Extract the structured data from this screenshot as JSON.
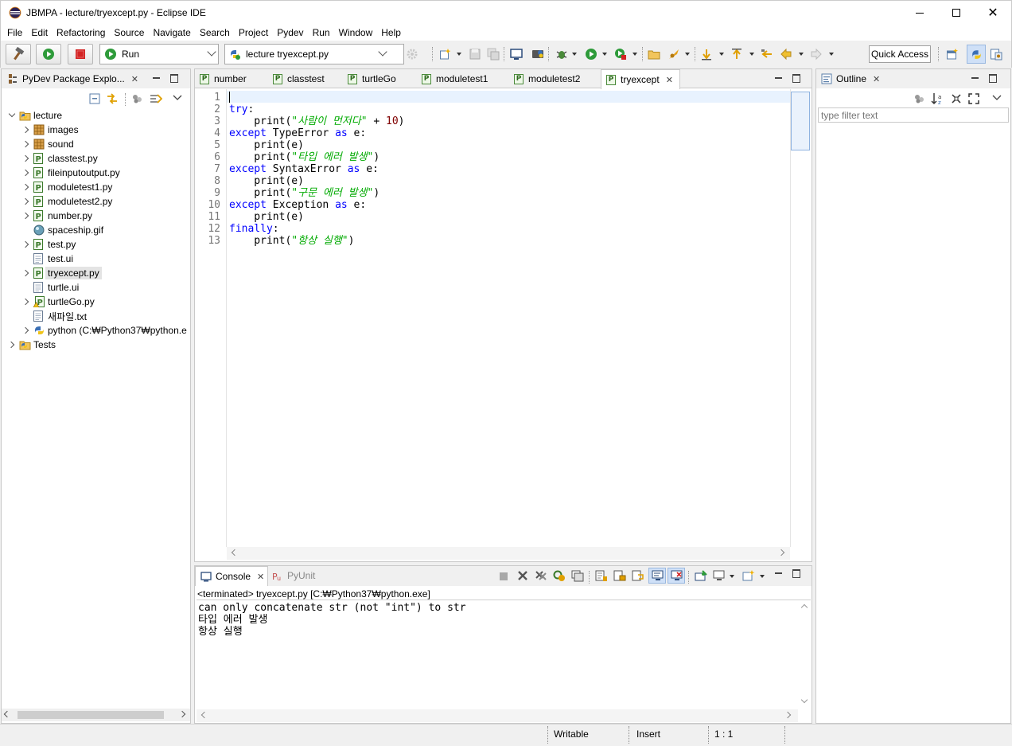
{
  "window": {
    "title": "JBMPA - lecture/tryexcept.py - Eclipse IDE"
  },
  "menu": [
    "File",
    "Edit",
    "Refactoring",
    "Source",
    "Navigate",
    "Search",
    "Project",
    "Pydev",
    "Run",
    "Window",
    "Help"
  ],
  "toolbar": {
    "run_config": "Run",
    "launch_target": "lecture tryexcept.py",
    "quick_access": "Quick Access"
  },
  "explorer": {
    "title": "PyDev Package Explo...",
    "items": [
      {
        "label": "lecture",
        "icon": "project-icon",
        "level": 0,
        "expand": "down"
      },
      {
        "label": "images",
        "icon": "package-folder-icon",
        "level": 1,
        "expand": "right"
      },
      {
        "label": "sound",
        "icon": "package-folder-icon",
        "level": 1,
        "expand": "right"
      },
      {
        "label": "classtest.py",
        "icon": "python-file-icon",
        "level": 1,
        "expand": "right"
      },
      {
        "label": "fileinputoutput.py",
        "icon": "python-file-icon",
        "level": 1,
        "expand": "right"
      },
      {
        "label": "moduletest1.py",
        "icon": "python-file-icon",
        "level": 1,
        "expand": "right"
      },
      {
        "label": "moduletest2.py",
        "icon": "python-file-icon",
        "level": 1,
        "expand": "right"
      },
      {
        "label": "number.py",
        "icon": "python-file-icon",
        "level": 1,
        "expand": "right"
      },
      {
        "label": "spaceship.gif",
        "icon": "image-file-icon",
        "level": 1,
        "expand": ""
      },
      {
        "label": "test.py",
        "icon": "python-file-icon",
        "level": 1,
        "expand": "right"
      },
      {
        "label": "test.ui",
        "icon": "text-file-icon",
        "level": 1,
        "expand": ""
      },
      {
        "label": "tryexcept.py",
        "icon": "python-file-icon",
        "level": 1,
        "expand": "right",
        "selected": true
      },
      {
        "label": "turtle.ui",
        "icon": "text-file-icon",
        "level": 1,
        "expand": ""
      },
      {
        "label": "turtleGo.py",
        "icon": "python-file-warning-icon",
        "level": 1,
        "expand": "right"
      },
      {
        "label": "새파일.txt",
        "icon": "text-file-icon",
        "level": 1,
        "expand": ""
      },
      {
        "label": "python  (C:₩Python37₩python.e",
        "icon": "python-interpreter-icon",
        "level": 1,
        "expand": "right"
      },
      {
        "label": "Tests",
        "icon": "project-icon",
        "level": 0,
        "expand": "right"
      }
    ]
  },
  "editor": {
    "tabs": [
      "number",
      "classtest",
      "turtleGo",
      "moduletest1",
      "moduletest2",
      "tryexcept"
    ],
    "active_tab": "tryexcept",
    "line_numbers": [
      "1",
      "2",
      "3",
      "4",
      "5",
      "6",
      "7",
      "8",
      "9",
      "10",
      "11",
      "12",
      "13"
    ],
    "lines": [
      [],
      [
        {
          "t": "try",
          "c": "kw"
        },
        {
          "t": ":",
          "c": ""
        }
      ],
      [
        {
          "t": "    print(",
          "c": ""
        },
        {
          "t": "\"사람이 먼저다\"",
          "c": "str"
        },
        {
          "t": " + ",
          "c": ""
        },
        {
          "t": "10",
          "c": "num"
        },
        {
          "t": ")",
          "c": ""
        }
      ],
      [
        {
          "t": "except",
          "c": "kw"
        },
        {
          "t": " TypeError ",
          "c": ""
        },
        {
          "t": "as",
          "c": "kw"
        },
        {
          "t": " e:",
          "c": ""
        }
      ],
      [
        {
          "t": "    print(e)",
          "c": ""
        }
      ],
      [
        {
          "t": "    print(",
          "c": ""
        },
        {
          "t": "\"타입 에러 발생\"",
          "c": "str"
        },
        {
          "t": ")",
          "c": ""
        }
      ],
      [
        {
          "t": "except",
          "c": "kw"
        },
        {
          "t": " SyntaxError ",
          "c": ""
        },
        {
          "t": "as",
          "c": "kw"
        },
        {
          "t": " e:",
          "c": ""
        }
      ],
      [
        {
          "t": "    print(e)",
          "c": ""
        }
      ],
      [
        {
          "t": "    print(",
          "c": ""
        },
        {
          "t": "\"구문 에러 발생\"",
          "c": "str"
        },
        {
          "t": ")",
          "c": ""
        }
      ],
      [
        {
          "t": "except",
          "c": "kw"
        },
        {
          "t": " Exception ",
          "c": ""
        },
        {
          "t": "as",
          "c": "kw"
        },
        {
          "t": " e:",
          "c": ""
        }
      ],
      [
        {
          "t": "    print(e)",
          "c": ""
        }
      ],
      [
        {
          "t": "finally",
          "c": "kw"
        },
        {
          "t": ":",
          "c": ""
        }
      ],
      [
        {
          "t": "    print(",
          "c": ""
        },
        {
          "t": "\"항상 실행\"",
          "c": "str"
        },
        {
          "t": ")",
          "c": ""
        }
      ]
    ]
  },
  "outline": {
    "title": "Outline",
    "filter_placeholder": "type filter text"
  },
  "console": {
    "tabs": [
      "Console",
      "PyUnit"
    ],
    "header": "<terminated> tryexcept.py [C:₩Python37₩python.exe]",
    "output": [
      "can only concatenate str (not \"int\") to str",
      "타입 에러 발생",
      "항상 실행"
    ]
  },
  "status": {
    "writable": "Writable",
    "insert": "Insert",
    "position": "1 : 1"
  },
  "colors": {
    "keyword": "#0000ff",
    "string": "#00aa00",
    "number": "#800000",
    "selection": "#e4e4e4",
    "current_line": "#e8f2fe"
  }
}
